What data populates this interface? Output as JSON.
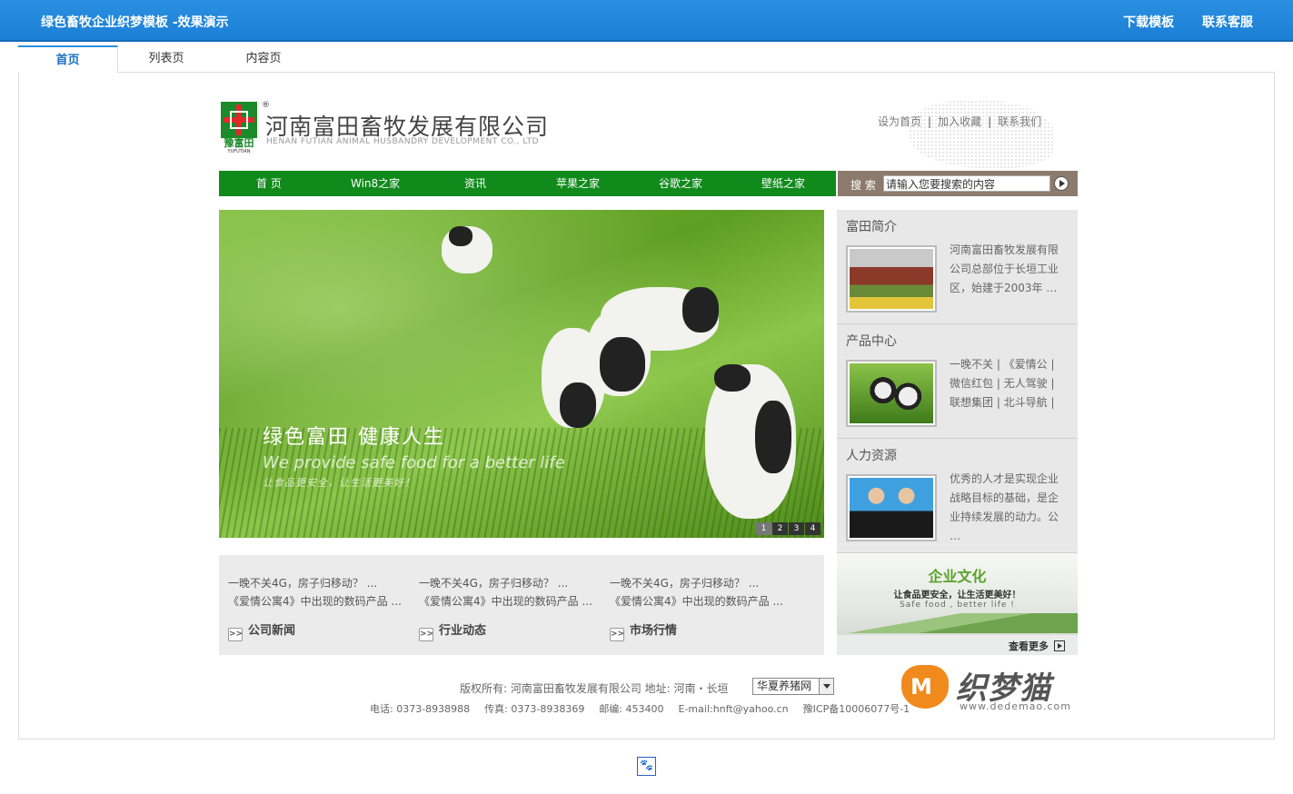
{
  "topbar": {
    "title": "绿色畜牧企业织梦模板 -效果演示",
    "download": "下载模板",
    "support": "联系客服"
  },
  "demo_tabs": [
    "首页",
    "列表页",
    "内容页"
  ],
  "company": {
    "name_cn": "河南富田畜牧发展有限公司",
    "name_en": "HENAN FUTIAN ANIMAL HUSBANDRY DEVELOPMENT CO., LTD",
    "brand_cn": "豫富田",
    "brand_en": "YUFUTIAN",
    "reg": "®"
  },
  "util_links": [
    "设为首页",
    "加入收藏",
    "联系我们"
  ],
  "util_sep": "|",
  "nav": [
    "首 页",
    "Win8之家",
    "资讯",
    "苹果之家",
    "谷歌之家",
    "壁纸之家"
  ],
  "search": {
    "label": "搜 索",
    "value": "请输入您要搜索的内容"
  },
  "banner": {
    "title": "绿色富田  健康人生",
    "en": "We provide safe food for a better life",
    "sub": "让食品更安全，让生活更美好！",
    "pages": [
      "1",
      "2",
      "3",
      "4"
    ]
  },
  "news": [
    {
      "line1": "一晚不关4G，房子归移动？ ...",
      "line2": "《爱情公寓4》中出现的数码产品 ...",
      "more": "公司新闻"
    },
    {
      "line1": "一晚不关4G，房子归移动？ ...",
      "line2": "《爱情公寓4》中出现的数码产品 ...",
      "more": "行业动态"
    },
    {
      "line1": "一晚不关4G，房子归移动？ ...",
      "line2": "《爱情公寓4》中出现的数码产品 ...",
      "more": "市场行情"
    }
  ],
  "news_chev": ">>",
  "side": {
    "intro": {
      "title": "富田简介",
      "text": "河南富田畜牧发展有限公司总部位于长垣工业区，始建于2003年 …"
    },
    "products": {
      "title": "产品中心",
      "text": "一晚不关 | 《爱情公 | 微信红包 | 无人驾驶 | 联想集团 | 北斗导航 |"
    },
    "hr": {
      "title": "人力资源",
      "text": "优秀的人才是实现企业战略目标的基础，是企业持续发展的动力。公 …"
    }
  },
  "culture": {
    "title": "企业文化",
    "sub": "让食品更安全，让生活更美好！",
    "en": "Safe food , better life !",
    "more": "查看更多"
  },
  "footer": {
    "copyright": "版权所有: 河南富田畜牧发展有限公司  地址: 河南・长垣",
    "select": "华夏养猪网",
    "tel": "电话: 0373-8938988",
    "fax": "传真: 0373-8938369",
    "zip": "邮编: 453400",
    "email": "E-mail:hnft@yahoo.cn",
    "icp": "豫ICP备10006077号-1"
  },
  "watermark": {
    "name": "织梦猫",
    "url": "www.dedemao.com"
  }
}
